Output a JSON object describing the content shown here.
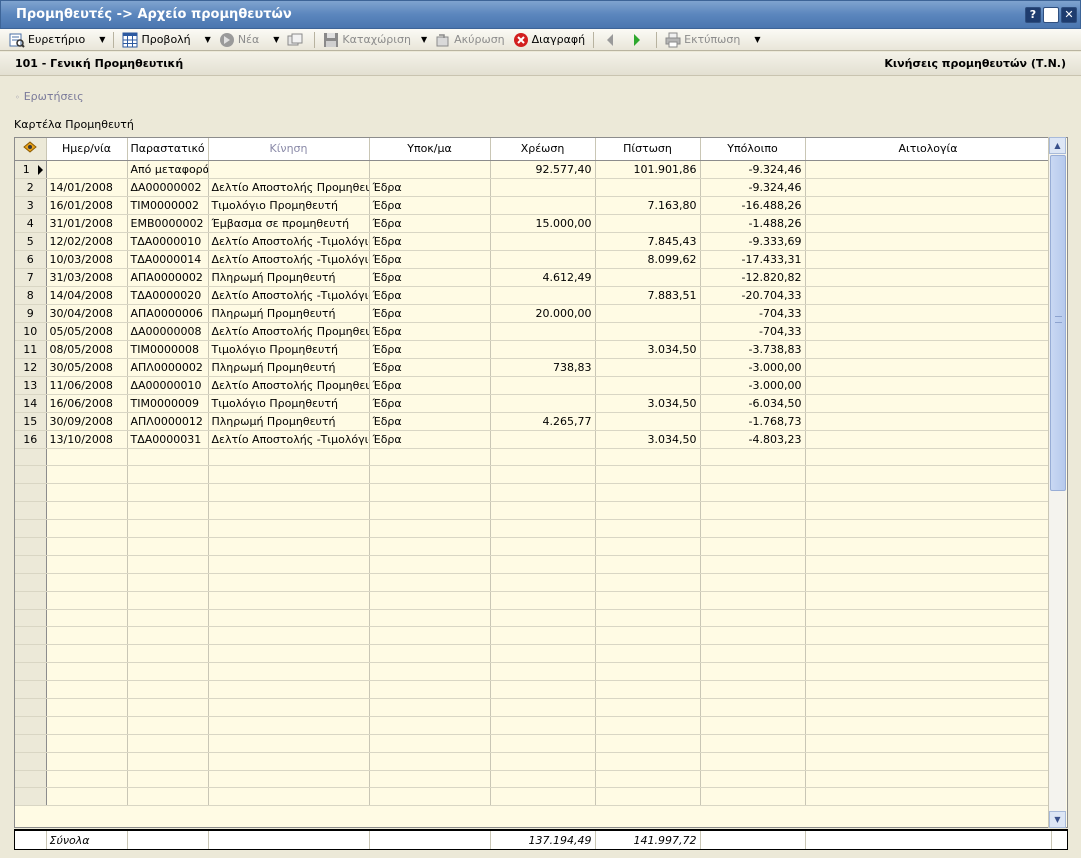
{
  "window": {
    "title": "Προμηθευτές -> Αρχείο προμηθευτών",
    "buttons": {
      "help": "?",
      "close": "✕"
    }
  },
  "toolbar": {
    "index": "Ευρετήριο",
    "view": "Προβολή",
    "new": "Νέα",
    "save": "Καταχώριση",
    "cancel": "Ακύρωση",
    "delete": "Διαγραφή",
    "print": "Εκτύπωση"
  },
  "header": {
    "left": "101 - Γενική Προμηθευτική",
    "right": "Κινήσεις προμηθευτών (Τ.Ν.)"
  },
  "queries_link": "Ερωτήσεις",
  "card_title": "Καρτέλα Προμηθευτή",
  "grid": {
    "columns": [
      "Ημερ/νία",
      "Παραστατικό",
      "Κίνηση",
      "Υποκ/μα",
      "Χρέωση",
      "Πίστωση",
      "Υπόλοιπο",
      "Αιτιολογία"
    ],
    "rows": [
      {
        "n": "1",
        "date": "",
        "doc": "Από μεταφορά",
        "move": "",
        "branch": "",
        "debit": "92.577,40",
        "credit": "101.901,86",
        "balance": "-9.324,46",
        "reason": ""
      },
      {
        "n": "2",
        "date": "14/01/2008",
        "doc": "ΔΑ00000002",
        "move": "Δελτίο Αποστολής Προμηθευτή",
        "branch": "Έδρα",
        "debit": "",
        "credit": "",
        "balance": "-9.324,46",
        "reason": ""
      },
      {
        "n": "3",
        "date": "16/01/2008",
        "doc": "ΤΙΜ0000002",
        "move": "Τιμολόγιο Προμηθευτή",
        "branch": "Έδρα",
        "debit": "",
        "credit": "7.163,80",
        "balance": "-16.488,26",
        "reason": ""
      },
      {
        "n": "4",
        "date": "31/01/2008",
        "doc": "ΕΜΒ0000002",
        "move": "Έμβασμα σε προμηθευτή",
        "branch": "Έδρα",
        "debit": "15.000,00",
        "credit": "",
        "balance": "-1.488,26",
        "reason": ""
      },
      {
        "n": "5",
        "date": "12/02/2008",
        "doc": "ΤΔΑ0000010",
        "move": "Δελτίο Αποστολής -Τιμολόγιο",
        "branch": "Έδρα",
        "debit": "",
        "credit": "7.845,43",
        "balance": "-9.333,69",
        "reason": ""
      },
      {
        "n": "6",
        "date": "10/03/2008",
        "doc": "ΤΔΑ0000014",
        "move": "Δελτίο Αποστολής -Τιμολόγιο",
        "branch": "Έδρα",
        "debit": "",
        "credit": "8.099,62",
        "balance": "-17.433,31",
        "reason": ""
      },
      {
        "n": "7",
        "date": "31/03/2008",
        "doc": "ΑΠΑ0000002",
        "move": "Πληρωμή Προμηθευτή",
        "branch": "Έδρα",
        "debit": "4.612,49",
        "credit": "",
        "balance": "-12.820,82",
        "reason": ""
      },
      {
        "n": "8",
        "date": "14/04/2008",
        "doc": "ΤΔΑ0000020",
        "move": "Δελτίο Αποστολής -Τιμολόγιο",
        "branch": "Έδρα",
        "debit": "",
        "credit": "7.883,51",
        "balance": "-20.704,33",
        "reason": ""
      },
      {
        "n": "9",
        "date": "30/04/2008",
        "doc": "ΑΠΑ0000006",
        "move": "Πληρωμή Προμηθευτή",
        "branch": "Έδρα",
        "debit": "20.000,00",
        "credit": "",
        "balance": "-704,33",
        "reason": ""
      },
      {
        "n": "10",
        "date": "05/05/2008",
        "doc": "ΔΑ00000008",
        "move": "Δελτίο Αποστολής Προμηθευτή",
        "branch": "Έδρα",
        "debit": "",
        "credit": "",
        "balance": "-704,33",
        "reason": ""
      },
      {
        "n": "11",
        "date": "08/05/2008",
        "doc": "ΤΙΜ0000008",
        "move": "Τιμολόγιο Προμηθευτή",
        "branch": "Έδρα",
        "debit": "",
        "credit": "3.034,50",
        "balance": "-3.738,83",
        "reason": ""
      },
      {
        "n": "12",
        "date": "30/05/2008",
        "doc": "ΑΠΛ0000002",
        "move": "Πληρωμή Προμηθευτή",
        "branch": "Έδρα",
        "debit": "738,83",
        "credit": "",
        "balance": "-3.000,00",
        "reason": ""
      },
      {
        "n": "13",
        "date": "11/06/2008",
        "doc": "ΔΑ00000010",
        "move": "Δελτίο Αποστολής Προμηθευτή",
        "branch": "Έδρα",
        "debit": "",
        "credit": "",
        "balance": "-3.000,00",
        "reason": ""
      },
      {
        "n": "14",
        "date": "16/06/2008",
        "doc": "ΤΙΜ0000009",
        "move": "Τιμολόγιο Προμηθευτή",
        "branch": "Έδρα",
        "debit": "",
        "credit": "3.034,50",
        "balance": "-6.034,50",
        "reason": ""
      },
      {
        "n": "15",
        "date": "30/09/2008",
        "doc": "ΑΠΛ0000012",
        "move": "Πληρωμή Προμηθευτή",
        "branch": "Έδρα",
        "debit": "4.265,77",
        "credit": "",
        "balance": "-1.768,73",
        "reason": ""
      },
      {
        "n": "16",
        "date": "13/10/2008",
        "doc": "ΤΔΑ0000031",
        "move": "Δελτίο Αποστολής -Τιμολόγιο",
        "branch": "Έδρα",
        "debit": "",
        "credit": "3.034,50",
        "balance": "-4.803,23",
        "reason": ""
      }
    ]
  },
  "totals": {
    "label": "Σύνολα",
    "debit": "137.194,49",
    "credit": "141.997,72"
  }
}
